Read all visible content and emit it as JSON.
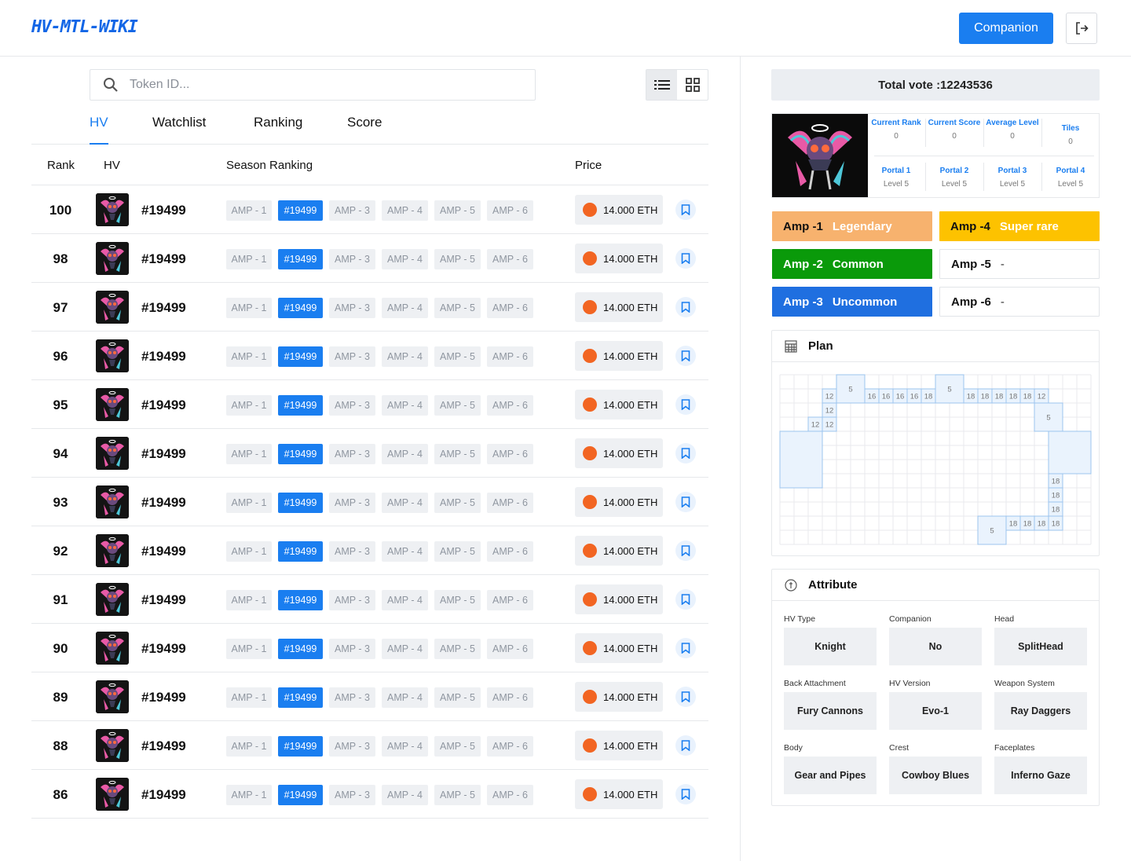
{
  "header": {
    "logo": "HV-MTL-WIKI",
    "companion_label": "Companion"
  },
  "search": {
    "placeholder": "Token ID..."
  },
  "tabs": [
    {
      "label": "HV",
      "active": true
    },
    {
      "label": "Watchlist",
      "active": false
    },
    {
      "label": "Ranking",
      "active": false
    },
    {
      "label": "Score",
      "active": false
    }
  ],
  "table": {
    "headers": {
      "rank": "Rank",
      "hv": "HV",
      "season": "Season Ranking",
      "price": "Price"
    },
    "amps": [
      "AMP - 1",
      "#19499",
      "AMP - 3",
      "AMP - 4",
      "AMP - 5",
      "AMP - 6"
    ],
    "rows": [
      {
        "rank": "100",
        "hv": "#19499",
        "price": "14.000 ETH"
      },
      {
        "rank": "98",
        "hv": "#19499",
        "price": "14.000 ETH"
      },
      {
        "rank": "97",
        "hv": "#19499",
        "price": "14.000 ETH"
      },
      {
        "rank": "96",
        "hv": "#19499",
        "price": "14.000 ETH"
      },
      {
        "rank": "95",
        "hv": "#19499",
        "price": "14.000 ETH"
      },
      {
        "rank": "94",
        "hv": "#19499",
        "price": "14.000 ETH"
      },
      {
        "rank": "93",
        "hv": "#19499",
        "price": "14.000 ETH"
      },
      {
        "rank": "92",
        "hv": "#19499",
        "price": "14.000 ETH"
      },
      {
        "rank": "91",
        "hv": "#19499",
        "price": "14.000 ETH"
      },
      {
        "rank": "90",
        "hv": "#19499",
        "price": "14.000 ETH"
      },
      {
        "rank": "89",
        "hv": "#19499",
        "price": "14.000 ETH"
      },
      {
        "rank": "88",
        "hv": "#19499",
        "price": "14.000 ETH"
      },
      {
        "rank": "86",
        "hv": "#19499",
        "price": "14.000 ETH"
      }
    ]
  },
  "side": {
    "total_vote": "Total vote :12243536",
    "stats_top": [
      {
        "label": "Current Rank",
        "value": "0"
      },
      {
        "label": "Current Score",
        "value": "0"
      },
      {
        "label": "Average Level",
        "value": "0"
      },
      {
        "label": "Tiles",
        "value": "0"
      }
    ],
    "portals": [
      {
        "label": "Portal 1",
        "value": "Level 5"
      },
      {
        "label": "Portal 2",
        "value": "Level 5"
      },
      {
        "label": "Portal 3",
        "value": "Level 5"
      },
      {
        "label": "Portal 4",
        "value": "Level 5"
      }
    ],
    "amp_rarities": [
      {
        "name": "Amp -1",
        "rarity": "Legendary",
        "bg": "#f7b26e",
        "fg": "#ffffff",
        "name_color": "#111111"
      },
      {
        "name": "Amp -4",
        "rarity": "Super rare",
        "bg": "#fdc200",
        "fg": "#ffffff",
        "name_color": "#111111"
      },
      {
        "name": "Amp -2",
        "rarity": "Common",
        "bg": "#0a9a0a",
        "fg": "#ffffff",
        "name_color": "#ffffff"
      },
      {
        "name": "Amp -5",
        "rarity": "-",
        "bg": "#ffffff",
        "fg": "#333333",
        "name_color": "#111111"
      },
      {
        "name": "Amp -3",
        "rarity": "Uncommon",
        "bg": "#1f6fe0",
        "fg": "#ffffff",
        "name_color": "#ffffff"
      },
      {
        "name": "Amp -6",
        "rarity": "-",
        "bg": "#ffffff",
        "fg": "#333333",
        "name_color": "#111111"
      }
    ],
    "plan_title": "Plan",
    "plan_tiles": [
      "12",
      "5",
      "16",
      "16",
      "16",
      "16",
      "18",
      "5",
      "18",
      "18",
      "18",
      "18",
      "18",
      "12",
      "12",
      "5",
      "12",
      "12",
      "18",
      "18",
      "18",
      "18",
      "18",
      "18",
      "18",
      "5"
    ],
    "attribute_title": "Attribute",
    "attributes": [
      {
        "label": "HV Type",
        "value": "Knight"
      },
      {
        "label": "Companion",
        "value": "No"
      },
      {
        "label": "Head",
        "value": "SplitHead"
      },
      {
        "label": "Back Attachment",
        "value": "Fury Cannons"
      },
      {
        "label": "HV Version",
        "value": "Evo-1"
      },
      {
        "label": "Weapon System",
        "value": "Ray Daggers"
      },
      {
        "label": "Body",
        "value": "Gear and Pipes"
      },
      {
        "label": "Crest",
        "value": "Cowboy Blues"
      },
      {
        "label": "Faceplates",
        "value": "Inferno Gaze"
      }
    ]
  },
  "colors": {
    "accent": "#1a7ef0",
    "coin": "#f26522"
  },
  "icons": [
    "logout-icon",
    "search-icon",
    "list-view-icon",
    "grid-view-icon",
    "eth-coin-icon",
    "bookmark-icon",
    "plan-icon",
    "attribute-icon"
  ]
}
